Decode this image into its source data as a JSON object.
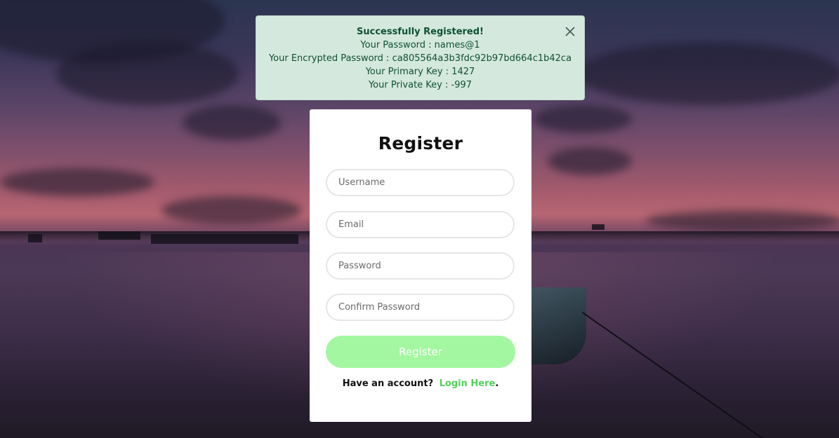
{
  "alert": {
    "title": "Successfully Registered!",
    "lines": [
      "Your Password : names@1",
      "Your Encrypted Password : ca805564a3b3fdc92b97bd664c1b42ca",
      "Your Primary Key : 1427",
      "Your Private Key : -997"
    ],
    "close_icon": "close-icon",
    "color": "#0f5132",
    "background": "#d4e8dd"
  },
  "form": {
    "title": "Register",
    "username_placeholder": "Username",
    "email_placeholder": "Email",
    "password_placeholder": "Password",
    "confirm_password_placeholder": "Confirm Password",
    "submit_label": "Register",
    "submit_color": "#a3f7a0",
    "footer_text": "Have an account?",
    "login_link": "Login Here",
    "footer_end": ".",
    "link_color": "#52d05a"
  }
}
